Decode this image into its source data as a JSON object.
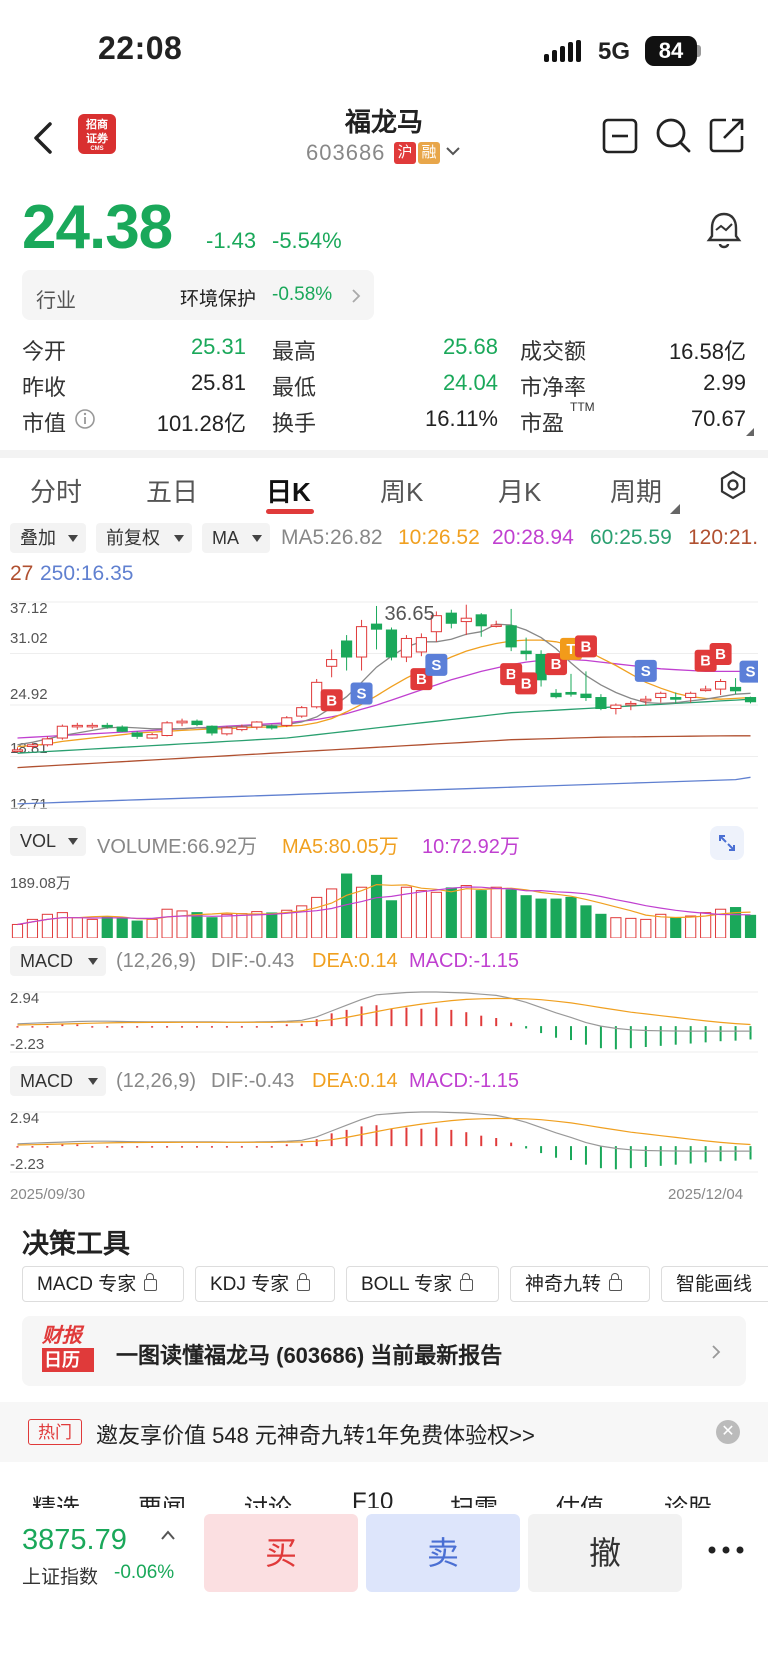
{
  "status_bar": {
    "time": "22:08",
    "network": "5G",
    "battery": "84"
  },
  "header": {
    "name": "福龙马",
    "code": "603686",
    "tag_hu": "沪",
    "tag_rong": "融",
    "broker_logo_line1": "招商",
    "broker_logo_line2": "证券",
    "broker_logo_line3": "CMS"
  },
  "quote": {
    "price": "24.38",
    "change": "-1.43",
    "change_pct": "-5.54%"
  },
  "industry": {
    "label": "行业",
    "name": "环境保护",
    "pct": "-0.58%"
  },
  "stats": {
    "open_label": "今开",
    "open": "25.31",
    "high_label": "最高",
    "high": "25.68",
    "turnover_amt_label": "成交额",
    "turnover_amt": "16.58亿",
    "prev_close_label": "昨收",
    "prev_close": "25.81",
    "low_label": "最低",
    "low": "24.04",
    "pb_label": "市净率",
    "pb": "2.99",
    "mktcap_label": "市值",
    "mktcap": "101.28亿",
    "turnover_rate_label": "换手",
    "turnover_rate": "16.11%",
    "pe_label": "市盈",
    "pe_sup": "TTM",
    "pe": "70.67"
  },
  "period_tabs": [
    "分时",
    "五日",
    "日K",
    "周K",
    "月K",
    "周期"
  ],
  "chips": {
    "overlay": "叠加",
    "adjust": "前复权",
    "ma": "MA"
  },
  "ma_legend": {
    "ma5": "MA5:26.82",
    "ma10": "10:26.52",
    "ma20": "20:28.94",
    "ma60": "60:25.59",
    "ma120_a": "120:21.",
    "ma120_b": "27",
    "ma250": "250:16.35"
  },
  "colors": {
    "up": "#e03a3a",
    "down": "#1aa85a",
    "ma5": "#888888",
    "ma10": "#f0a020",
    "ma20": "#c040d0",
    "ma60": "#2aa070",
    "ma120": "#b05030",
    "ma250": "#6080d0"
  },
  "kline_axis": {
    "y1": "37.12",
    "y2": "31.02",
    "y3": "24.92",
    "y4": "18.81",
    "y5": "12.71",
    "peak_label": "36.65"
  },
  "trade_marks": {
    "b": "B",
    "s": "S",
    "t": "T"
  },
  "volume": {
    "chip": "VOL",
    "volume": "VOLUME:66.92万",
    "ma5": "MA5:80.05万",
    "ma10": "10:72.92万",
    "max_label": "189.08万"
  },
  "macd": {
    "chip": "MACD",
    "params": "(12,26,9)",
    "dif": "DIF:-0.43",
    "dea": "DEA:0.14",
    "macd": "MACD:-1.15",
    "top": "2.94",
    "bottom": "-2.23"
  },
  "date_range": {
    "start": "2025/09/30",
    "end": "2025/12/04"
  },
  "tools": {
    "title": "决策工具",
    "items": [
      "MACD 专家",
      "KDJ 专家",
      "BOLL 专家",
      "神奇九转",
      "智能画线"
    ]
  },
  "report": {
    "logo_line1": "财报",
    "logo_line2": "日历",
    "text": "一图读懂福龙马 (603686) 当前最新报告"
  },
  "promo": {
    "tag": "热门",
    "text": "邀友享价值 548 元神奇九转1年免费体验权>>"
  },
  "bottom_tabs": [
    "精选",
    "要闻",
    "讨论",
    "F10",
    "扫雷",
    "估值",
    "诊股"
  ],
  "index": {
    "value": "3875.79",
    "name": "上证指数",
    "pct": "-0.06%"
  },
  "trade_buttons": {
    "buy": "买",
    "sell": "卖",
    "cancel": "撤"
  },
  "chart_data": {
    "type": "candlestick",
    "kline": [
      [
        19.6,
        19.9,
        19.3,
        19.6
      ],
      [
        20.0,
        20.4,
        19.7,
        20.2
      ],
      [
        20.2,
        21.2,
        20.0,
        20.9
      ],
      [
        21.0,
        22.6,
        20.8,
        22.4
      ],
      [
        22.5,
        22.8,
        22.0,
        22.5
      ],
      [
        22.5,
        22.8,
        22.1,
        22.5
      ],
      [
        22.5,
        22.8,
        22.1,
        22.3
      ],
      [
        22.3,
        22.5,
        21.7,
        21.8
      ],
      [
        21.6,
        21.8,
        20.9,
        21.2
      ],
      [
        21.0,
        21.6,
        20.9,
        21.4
      ],
      [
        21.3,
        23.0,
        21.2,
        22.8
      ],
      [
        22.8,
        23.3,
        22.4,
        23.0
      ],
      [
        23.0,
        23.2,
        22.4,
        22.6
      ],
      [
        22.4,
        22.5,
        21.3,
        21.6
      ],
      [
        21.5,
        22.4,
        21.3,
        22.2
      ],
      [
        22.0,
        22.6,
        21.8,
        22.3
      ],
      [
        22.3,
        23.0,
        22.0,
        22.9
      ],
      [
        22.4,
        22.6,
        22.0,
        22.2
      ],
      [
        22.5,
        23.6,
        22.3,
        23.4
      ],
      [
        23.6,
        24.8,
        23.4,
        24.6
      ],
      [
        24.7,
        28.0,
        24.5,
        27.6
      ],
      [
        29.5,
        31.5,
        28.2,
        30.3
      ],
      [
        32.5,
        33.2,
        29.0,
        30.6
      ],
      [
        30.6,
        35.0,
        29.0,
        34.2
      ],
      [
        34.5,
        36.65,
        31.5,
        33.9
      ],
      [
        33.8,
        34.1,
        30.2,
        30.6
      ],
      [
        30.6,
        33.2,
        30.0,
        32.8
      ],
      [
        31.2,
        33.4,
        30.7,
        32.9
      ],
      [
        33.6,
        36.0,
        32.4,
        35.5
      ],
      [
        35.8,
        36.2,
        34.0,
        34.6
      ],
      [
        34.8,
        36.8,
        33.2,
        35.2
      ],
      [
        35.6,
        35.8,
        33.0,
        34.3
      ],
      [
        34.4,
        34.9,
        34.1,
        34.4
      ],
      [
        34.3,
        36.3,
        31.3,
        31.8
      ],
      [
        31.3,
        32.9,
        30.2,
        31.0
      ],
      [
        30.9,
        31.4,
        27.1,
        27.9
      ],
      [
        26.3,
        26.8,
        25.7,
        25.9
      ],
      [
        26.4,
        28.6,
        25.9,
        26.2
      ],
      [
        26.2,
        28.9,
        25.4,
        25.8
      ],
      [
        25.8,
        26.2,
        24.3,
        24.5
      ],
      [
        24.5,
        25.1,
        23.8,
        24.9
      ],
      [
        25.0,
        25.4,
        24.3,
        25.1
      ],
      [
        25.4,
        26.0,
        24.9,
        25.6
      ],
      [
        25.8,
        26.5,
        25.2,
        26.3
      ],
      [
        25.8,
        26.4,
        25.1,
        25.6
      ],
      [
        25.8,
        26.5,
        25.2,
        26.3
      ],
      [
        26.7,
        27.2,
        26.5,
        26.8
      ],
      [
        26.8,
        28.0,
        26.1,
        27.7
      ],
      [
        27.0,
        28.1,
        26.2,
        26.6
      ],
      [
        25.8,
        25.9,
        25.1,
        25.3
      ]
    ],
    "ma5": [
      20.2,
      20.5,
      20.9,
      21.3,
      21.6,
      21.9,
      22.2,
      22.3,
      22.2,
      22.1,
      22.1,
      22.1,
      22.2,
      22.2,
      22.3,
      22.4,
      22.5,
      22.5,
      22.6,
      22.9,
      23.5,
      24.6,
      25.9,
      27.6,
      29.4,
      30.7,
      31.8,
      32.4,
      32.4,
      32.7,
      33.3,
      33.6,
      34.5,
      34.4,
      33.8,
      32.9,
      31.6,
      29.9,
      28.4,
      27.3,
      26.4,
      25.7,
      25.2,
      25.1,
      25.2,
      25.4,
      25.6,
      25.9,
      26.2,
      26.3
    ],
    "ma10": [
      20.0,
      20.1,
      20.3,
      20.6,
      20.8,
      21.0,
      21.2,
      21.4,
      21.6,
      21.7,
      21.8,
      21.9,
      22.0,
      22.1,
      22.1,
      22.2,
      22.3,
      22.3,
      22.4,
      22.5,
      22.8,
      23.3,
      24.1,
      25.0,
      26.0,
      27.1,
      28.1,
      29.0,
      29.8,
      30.6,
      31.3,
      31.8,
      32.2,
      32.5,
      32.6,
      32.6,
      32.4,
      32.0,
      31.4,
      30.5,
      29.6,
      28.6,
      27.6,
      26.9,
      26.3,
      25.9,
      25.7,
      25.6,
      25.7,
      25.8
    ],
    "ma20": [
      21.0,
      21.1,
      21.2,
      21.3,
      21.4,
      21.5,
      21.6,
      21.7,
      21.8,
      21.9,
      22.0,
      22.1,
      22.2,
      22.3,
      22.4,
      22.5,
      22.6,
      22.7,
      22.8,
      23.0,
      23.2,
      23.5,
      23.9,
      24.4,
      24.9,
      25.5,
      26.1,
      26.7,
      27.3,
      27.9,
      28.4,
      28.9,
      29.3,
      29.7,
      30.0,
      30.2,
      30.3,
      30.3,
      30.2,
      30.0,
      29.8,
      29.6,
      29.4,
      29.2,
      29.1,
      29.0,
      28.9,
      28.9,
      28.9,
      28.9
    ],
    "ma60": [
      19.2,
      19.3,
      19.4,
      19.5,
      19.6,
      19.7,
      19.8,
      19.9,
      20.0,
      20.1,
      20.2,
      20.3,
      20.4,
      20.5,
      20.6,
      20.7,
      20.8,
      20.9,
      21.0,
      21.2,
      21.4,
      21.6,
      21.8,
      22.0,
      22.2,
      22.4,
      22.6,
      22.8,
      23.0,
      23.2,
      23.4,
      23.6,
      23.8,
      24.0,
      24.1,
      24.2,
      24.3,
      24.4,
      24.5,
      24.6,
      24.7,
      24.8,
      24.9,
      25.0,
      25.1,
      25.2,
      25.3,
      25.4,
      25.5,
      25.6
    ],
    "ma120": [
      17.5,
      17.6,
      17.7,
      17.8,
      17.9,
      18.0,
      18.1,
      18.2,
      18.3,
      18.4,
      18.5,
      18.6,
      18.7,
      18.8,
      18.9,
      19.0,
      19.1,
      19.2,
      19.3,
      19.4,
      19.5,
      19.6,
      19.7,
      19.8,
      19.9,
      20.0,
      20.1,
      20.2,
      20.3,
      20.4,
      20.5,
      20.6,
      20.7,
      20.8,
      20.85,
      20.9,
      20.95,
      21.0,
      21.05,
      21.1,
      21.12,
      21.14,
      21.16,
      21.18,
      21.2,
      21.22,
      21.24,
      21.25,
      21.26,
      21.27
    ],
    "ma250": [
      13.2,
      13.26,
      13.32,
      13.38,
      13.44,
      13.5,
      13.56,
      13.62,
      13.68,
      13.74,
      13.8,
      13.86,
      13.92,
      13.98,
      14.04,
      14.1,
      14.16,
      14.22,
      14.28,
      14.34,
      14.4,
      14.46,
      14.52,
      14.58,
      14.64,
      14.7,
      14.76,
      14.82,
      14.88,
      14.94,
      15.0,
      15.06,
      15.12,
      15.18,
      15.24,
      15.3,
      15.36,
      15.42,
      15.48,
      15.54,
      15.6,
      15.66,
      15.72,
      15.78,
      15.84,
      15.9,
      15.96,
      16.02,
      16.08,
      16.35
    ],
    "volume": [
      40,
      55,
      70,
      75,
      60,
      55,
      62,
      58,
      50,
      55,
      85,
      80,
      75,
      60,
      70,
      72,
      78,
      74,
      82,
      95,
      120,
      145,
      189,
      150,
      185,
      110,
      150,
      140,
      135,
      148,
      155,
      140,
      150,
      142,
      125,
      115,
      115,
      120,
      95,
      70,
      60,
      58,
      55,
      70,
      60,
      65,
      75,
      85,
      90,
      67
    ],
    "macd_hist": [
      0.05,
      0.08,
      0.12,
      0.15,
      0.14,
      0.12,
      0.1,
      0.08,
      0.06,
      0.05,
      0.06,
      0.07,
      0.06,
      0.05,
      0.05,
      0.06,
      0.08,
      0.1,
      0.15,
      0.2,
      0.6,
      1.1,
      1.4,
      1.7,
      1.8,
      1.5,
      1.6,
      1.5,
      1.6,
      1.4,
      1.2,
      0.9,
      0.7,
      0.3,
      -0.2,
      -0.6,
      -1.0,
      -1.2,
      -1.6,
      -1.9,
      -2.0,
      -1.9,
      -1.8,
      -1.7,
      -1.6,
      -1.5,
      -1.4,
      -1.3,
      -1.25,
      -1.15
    ],
    "dif": [
      0.2,
      0.25,
      0.3,
      0.35,
      0.4,
      0.42,
      0.42,
      0.4,
      0.38,
      0.36,
      0.36,
      0.37,
      0.37,
      0.36,
      0.35,
      0.35,
      0.36,
      0.38,
      0.42,
      0.5,
      0.8,
      1.3,
      1.8,
      2.3,
      2.7,
      2.8,
      2.9,
      2.94,
      2.94,
      2.9,
      2.85,
      2.75,
      2.65,
      2.4,
      2.05,
      1.6,
      1.15,
      0.75,
      0.3,
      0.0,
      -0.2,
      -0.32,
      -0.38,
      -0.4,
      -0.42,
      -0.43,
      -0.43,
      -0.43,
      -0.43,
      -0.43
    ],
    "dea": [
      0.1,
      0.12,
      0.15,
      0.18,
      0.22,
      0.25,
      0.28,
      0.3,
      0.31,
      0.32,
      0.32,
      0.33,
      0.33,
      0.33,
      0.33,
      0.33,
      0.33,
      0.33,
      0.34,
      0.36,
      0.42,
      0.55,
      0.75,
      1.0,
      1.25,
      1.5,
      1.7,
      1.9,
      2.05,
      2.2,
      2.3,
      2.35,
      2.38,
      2.38,
      2.35,
      2.28,
      2.15,
      2.0,
      1.8,
      1.6,
      1.4,
      1.2,
      1.05,
      0.9,
      0.75,
      0.6,
      0.45,
      0.32,
      0.22,
      0.14
    ],
    "ylim_price": [
      12.71,
      37.12
    ],
    "ylim_volume": [
      0,
      189.08
    ],
    "ylim_macd": [
      -2.23,
      2.94
    ]
  }
}
